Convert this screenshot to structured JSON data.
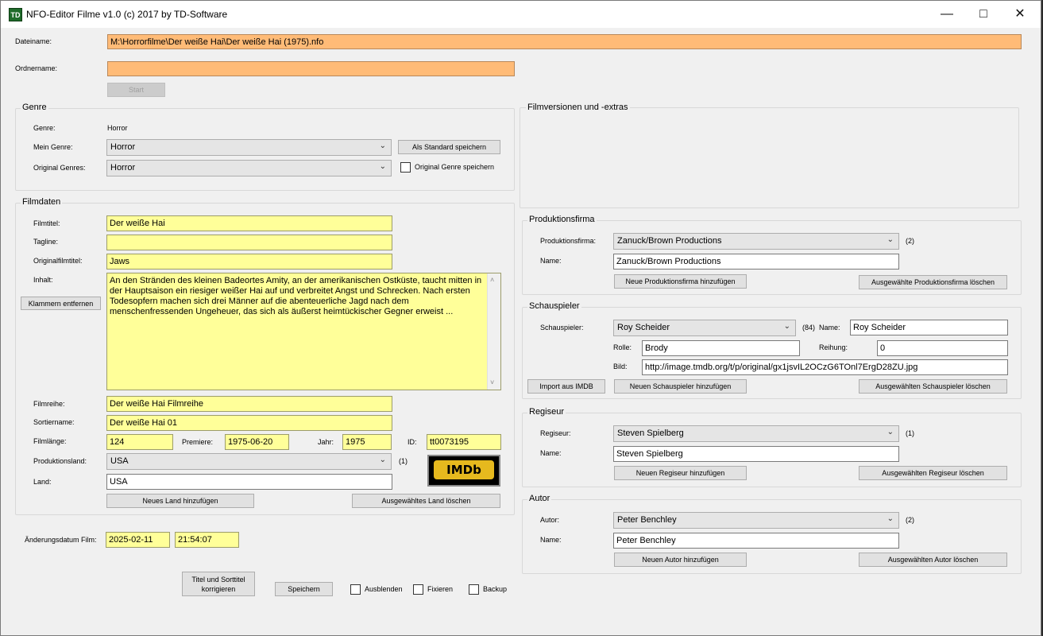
{
  "window": {
    "title": "NFO-Editor Filme v1.0 (c) 2017 by TD-Software",
    "icon_text": "TD"
  },
  "file": {
    "dateiname_label": "Dateiname:",
    "dateiname_value": "M:\\Horrorfilme\\Der weiße Hai\\Der weiße Hai (1975).nfo",
    "ordnername_label": "Ordnername:",
    "ordnername_value": "",
    "start_button": "Start"
  },
  "genre": {
    "group_title": "Genre",
    "genre_label": "Genre:",
    "genre_value": "Horror",
    "mein_genre_label": "Mein Genre:",
    "mein_genre_value": "Horror",
    "als_standard_button": "Als Standard speichern",
    "original_genres_label": "Original Genres:",
    "original_genres_value": "Horror",
    "original_genre_speichern_label": "Original Genre speichern"
  },
  "filmdaten": {
    "group_title": "Filmdaten",
    "filmtitel_label": "Filmtitel:",
    "filmtitel_value": "Der weiße Hai",
    "tagline_label": "Tagline:",
    "tagline_value": "",
    "originalfilmtitel_label": "Originalfilmtitel:",
    "originalfilmtitel_value": "Jaws",
    "inhalt_label": "Inhalt:",
    "klammern_button": "Klammern entfernen",
    "inhalt_value": "An den Stränden des kleinen Badeortes Amity, an der amerikanischen Ostküste, taucht mitten in der Hauptsaison ein riesiger weißer Hai auf und verbreitet Angst und Schrecken. Nach ersten Todesopfern machen sich drei Männer auf die abenteuerliche Jagd nach dem menschenfressenden Ungeheuer, das sich als äußerst heimtückischer Gegner erweist ...",
    "filmreihe_label": "Filmreihe:",
    "filmreihe_value": "Der weiße Hai Filmreihe",
    "sortiername_label": "Sortiername:",
    "sortiername_value": "Der weiße Hai 01",
    "filmlaenge_label": "Filmlänge:",
    "filmlaenge_value": "124",
    "premiere_label": "Premiere:",
    "premiere_value": "1975-06-20",
    "jahr_label": "Jahr:",
    "jahr_value": "1975",
    "id_label": "ID:",
    "id_value": "tt0073195",
    "produktionsland_label": "Produktionsland:",
    "produktionsland_value": "USA",
    "produktionsland_count": "(1)",
    "land_label": "Land:",
    "land_value": "USA",
    "imdb_logo": "IMDb",
    "neues_land_button": "Neues Land hinzufügen",
    "land_loeschen_button": "Ausgewähltes Land löschen"
  },
  "aenderung": {
    "label": "Änderungsdatum Film:",
    "date": "2025-02-11",
    "time": "21:54:07"
  },
  "bottom": {
    "titel_korrigieren_line1": "Titel und Sorttitel",
    "titel_korrigieren_line2": "korrigieren",
    "speichern_button": "Speichern",
    "ausblenden_label": "Ausblenden",
    "fixieren_label": "Fixieren",
    "backup_label": "Backup"
  },
  "filmversionen": {
    "group_title": "Filmversionen und -extras"
  },
  "produktionsfirma": {
    "group_title": "Produktionsfirma",
    "label": "Produktionsfirma:",
    "value": "Zanuck/Brown Productions",
    "count": "(2)",
    "name_label": "Name:",
    "name_value": "Zanuck/Brown Productions",
    "add_button": "Neue Produktionsfirma hinzufügen",
    "delete_button": "Ausgewählte Produktionsfirma löschen"
  },
  "schauspieler": {
    "group_title": "Schauspieler",
    "label": "Schauspieler:",
    "value": "Roy Scheider",
    "count": "(84)",
    "name_label": "Name:",
    "name_value": "Roy Scheider",
    "rolle_label": "Rolle:",
    "rolle_value": "Brody",
    "reihung_label": "Reihung:",
    "reihung_value": "0",
    "bild_label": "Bild:",
    "bild_value": "http://image.tmdb.org/t/p/original/gx1jsvIL2OCzG6TOnl7ErgD28ZU.jpg",
    "import_button": "Import aus IMDB",
    "add_button": "Neuen Schauspieler hinzufügen",
    "delete_button": "Ausgewählten Schauspieler löschen"
  },
  "regiseur": {
    "group_title": "Regiseur",
    "label": "Regiseur:",
    "value": "Steven Spielberg",
    "count": "(1)",
    "name_label": "Name:",
    "name_value": "Steven Spielberg",
    "add_button": "Neuen Regiseur hinzufügen",
    "delete_button": "Ausgewählten Regiseur löschen"
  },
  "autor": {
    "group_title": "Autor",
    "label": "Autor:",
    "value": "Peter Benchley",
    "count": "(2)",
    "name_label": "Name:",
    "name_value": "Peter Benchley",
    "add_button": "Neuen Autor hinzufügen",
    "delete_button": "Ausgewählten Autor löschen"
  },
  "colors": {
    "required_field": "#ffbb77",
    "filled_field": "#ffff99",
    "imdb_yellow": "#e6b91e"
  }
}
